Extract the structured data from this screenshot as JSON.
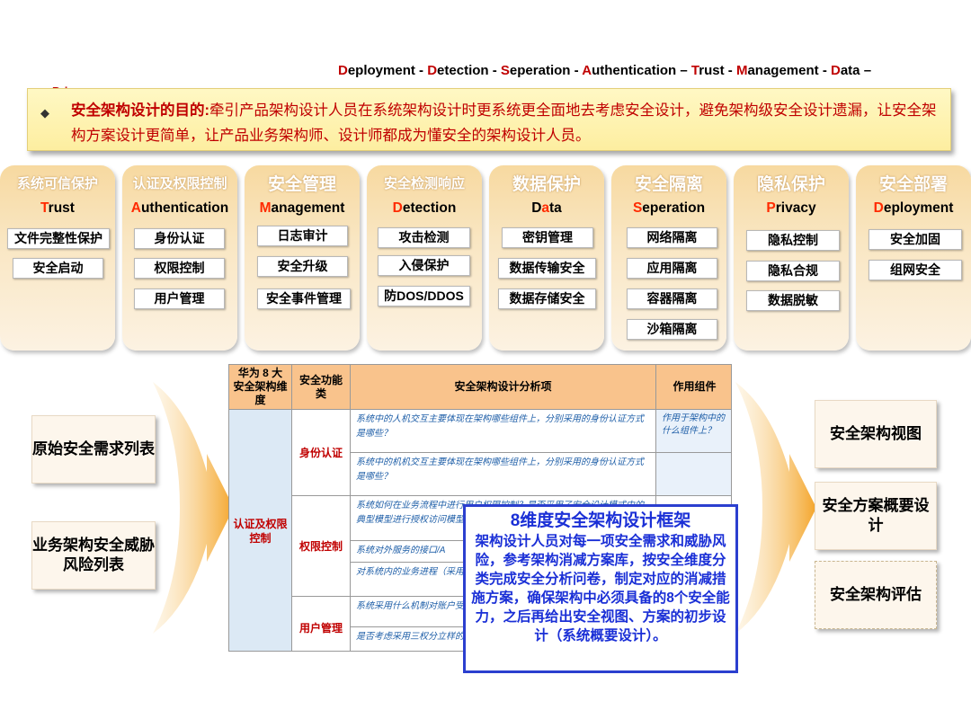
{
  "topline": {
    "parts": [
      {
        "initial": "D",
        "rest": "eployment"
      },
      {
        "sep": " - "
      },
      {
        "initial": "D",
        "rest": "etection"
      },
      {
        "sep": " - "
      },
      {
        "initial": "S",
        "rest": "eperation"
      },
      {
        "sep": " - "
      },
      {
        "initial": "A",
        "rest": "uthentication"
      },
      {
        "sep": " – "
      },
      {
        "initial": "T",
        "rest": "rust"
      },
      {
        "sep": " - "
      },
      {
        "initial": "M",
        "rest": "anagement"
      },
      {
        "sep": " - "
      },
      {
        "initial": "D",
        "rest": "ata"
      },
      {
        "sep": " –"
      }
    ],
    "overflow": "Privacy"
  },
  "purpose": {
    "label": "安全架构设计的目的:",
    "text": "牵引产品架构设计人员在系统架构设计时更系统更全面地去考虑安全设计，避免架构级安全设计遗漏，让安全架构方案设计更简单，让产品业务架构师、设计师都成为懂安全的架构设计人员。"
  },
  "columns": [
    {
      "cn": "系统可信保护",
      "en_initial": "T",
      "en_rest": "rust",
      "items": [
        "文件完整性保护",
        "安全启动"
      ]
    },
    {
      "cn": "认证及权限控制",
      "en_initial": "A",
      "en_rest": "uthentication",
      "items": [
        "身份认证",
        "权限控制",
        "用户管理"
      ]
    },
    {
      "cn": "安全管理",
      "en_initial": "M",
      "en_rest": "anagement",
      "items": [
        "日志审计",
        "安全升级",
        "安全事件管理"
      ]
    },
    {
      "cn": "安全检测响应",
      "en_initial": "D",
      "en_rest": "etection",
      "items": [
        "攻击检测",
        "入侵保护",
        "防DOS/DDOS"
      ]
    },
    {
      "cn": "数据保护",
      "en_initial": "D",
      "en_mid": "a",
      "en_rest": "ta",
      "items": [
        "密钥管理",
        "数据传输安全",
        "数据存储安全"
      ]
    },
    {
      "cn": "安全隔离",
      "en_initial": "S",
      "en_rest": "eperation",
      "items": [
        "网络隔离",
        "应用隔离",
        "容器隔离",
        "沙箱隔离"
      ]
    },
    {
      "cn": "隐私保护",
      "en_initial": "P",
      "en_rest": "rivacy",
      "items": [
        "隐私控制",
        "隐私合规",
        "数据脱敏"
      ]
    },
    {
      "cn": "安全部署",
      "en_initial": "D",
      "en_rest": "eployment",
      "items": [
        "安全加固",
        "组网安全"
      ]
    }
  ],
  "table": {
    "headers": [
      "华为 8 大安全架构维度",
      "安全功能类",
      "安全架构设计分析项",
      "作用组件"
    ],
    "dimension": "认证及权限控制",
    "groups": [
      {
        "name": "身份认证",
        "rows": [
          "系统中的人机交互主要体现在架构哪些组件上，分别采用的身份认证方式是哪些？",
          "系统中的机机交互主要体现在架构哪些组件上，分别采用的身份认证方式是哪些？"
        ]
      },
      {
        "name": "权限控制",
        "rows": [
          "系统如何在业务流程中进行用户权限控制？是否采用了安全设计模式中的典型模型进行授权访问模型、决策模型",
          "系统对外服务的接口/A",
          "对系统内的业务进程（采用了 Selinux、cgro"
        ]
      },
      {
        "name": "用户管理",
        "rows": [
          "系统采用什么机制对账户受到攻击的风",
          "是否考虑采用三权分立样的到场、管理、删除"
        ]
      }
    ],
    "component_note": "作用于架构中的什么组件上？"
  },
  "left_boxes": [
    "原始安全需求列表",
    "业务架构安全威胁风险列表"
  ],
  "right_boxes": [
    "安全架构视图",
    "安全方案概要设计",
    "安全架构评估"
  ],
  "framework": {
    "title": "8维度安全架构设计框架",
    "body": "架构设计人员对每一项安全需求和威胁风险，参考架构消减方案库，按安全维度分类完成安全分析问卷，制定对应的消减措施方案，确保架构中必须具备的8个安全能力，之后再给出安全视图、方案的初步设计（系统概要设计）。"
  },
  "colors": {
    "accent_red": "#c00000",
    "frame_blue": "#1a2fd6",
    "column_gradient": "#f7d9a0",
    "table_header": "#f9c38c"
  }
}
